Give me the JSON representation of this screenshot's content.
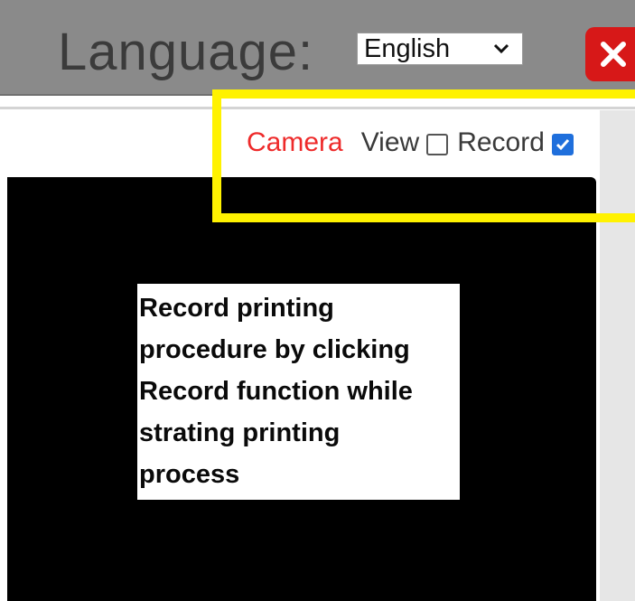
{
  "header": {
    "language_label": "Language:",
    "language_select": {
      "selected": "English"
    },
    "close_icon": "close-x-icon",
    "close_color": "#d71818"
  },
  "camera_controls": {
    "camera_label": "Camera",
    "view_label": "View",
    "view_checked": false,
    "record_label": "Record",
    "record_checked": true,
    "camera_label_color": "#ee2a2a"
  },
  "callout": {
    "lines": [
      "Record printing",
      "procedure by clicking",
      "Record function while",
      "strating printing",
      "process"
    ]
  },
  "highlight": {
    "color": "#fff200"
  }
}
